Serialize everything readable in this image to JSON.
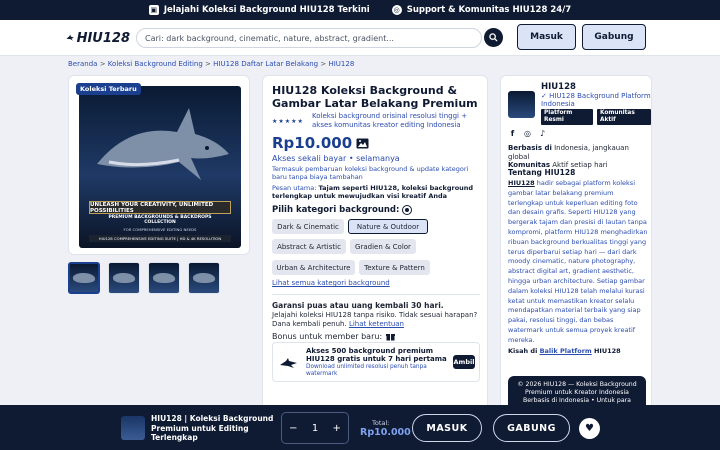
{
  "topbar": {
    "item1": "Jelajahi Koleksi Background HIU128 Terkini",
    "item2": "Support & Komunitas HIU128 24/7"
  },
  "header": {
    "brand": "HIU128",
    "search_placeholder": "Cari: dark background, cinematic, nature, abstract, gradient...",
    "masuk": "Masuk",
    "gabung": "Gabung"
  },
  "breadcrumb": [
    "Beranda",
    "Koleksi Background Editing",
    "HIU128 Daftar Latar Belakang",
    "HIU128"
  ],
  "gallery": {
    "badge": "Koleksi Terbaru",
    "hero_banner": "UNLEASH YOUR CREATIVITY, UNLIMITED POSSIBILITIES",
    "hero_sub1": "PREMIUM BACKGROUNDS & BACKDROPS COLLECTION",
    "hero_sub2": "FOR COMPREHENSIVE EDITING NEEDS",
    "hero_sub3": "HIU128 COMPREHENSIVE EDITING SUITE | HD & 4K RESOLUTION"
  },
  "product": {
    "title": "HIU128 Koleksi Background & Gambar Latar Belakang Premium",
    "stars": "★★★★★",
    "tagline": "Koleksi background orisinal resolusi tinggi + akses komunitas kreator editing Indonesia",
    "price": "Rp10.000",
    "access": "Akses sekali bayar • selamanya",
    "note": "Termasuk pembaruan koleksi background & update kategori baru tanpa biaya tambahan",
    "msg_label": "Pesan utama:",
    "msg_text": "Tajam seperti HIU128, koleksi background terlengkap untuk mewujudkan visi kreatif Anda",
    "pick_label": "Pilih kategori background:",
    "categories": [
      "Dark & Cinematic",
      "Nature & Outdoor",
      "Abstract & Artistic",
      "Gradien & Color",
      "Urban & Architecture",
      "Texture & Pattern"
    ],
    "selected_category": "Nature & Outdoor",
    "link": "Lihat semua kategori background",
    "guarantee_title": "Garansi puas atau uang kembali 30 hari.",
    "guarantee_text": "Jelajahi koleksi HIU128 tanpa risiko. Tidak sesuai harapan? Dana kembali penuh.",
    "guarantee_link": "Lihat ketentuan",
    "bonus_label": "Bonus untuk member baru:",
    "bonus_title": "Akses 500 background premium HIU128 gratis untuk 7 hari pertama",
    "bonus_sub": "Download unlimited resolusi penuh tanpa watermark",
    "bonus_btn": "Ambil"
  },
  "sidebar": {
    "name": "HIU128",
    "subtitle": "✓ HIU128 Background Platform Indonesia",
    "badges": [
      "Platform Resmi",
      "Komunitas Aktif"
    ],
    "based_label": "Berbasis di",
    "based_value": "Indonesia, jangkauan global",
    "community_label": "Komunitas",
    "community_value": "Aktif setiap hari",
    "about_title": "Tentang HIU128",
    "about_brand": "HIU128",
    "about_text": "hadir sebagai platform koleksi gambar latar belakang premium terlengkap untuk keperluan editing foto dan desain grafis. Seperti HIU128 yang bergerak tajam dan presisi di lautan tanpa kompromi, platform HIU128 menghadirkan ribuan background berkualitas tinggi yang terus diperbarui setiap hari — dari dark moody cinematic, nature photography, abstract digital art, gradient aesthetic, hingga urban architecture. Setiap gambar dalam koleksi HIU128 telah melalui kurasi ketat untuk memastikan kreator selalu mendapatkan material terbaik yang siap pakai, resolusi tinggi, dan bebas watermark untuk semua proyek kreatif mereka.",
    "story_prefix": "Kisah di",
    "story_link": "Balik Platform",
    "story_suffix": "HIU128"
  },
  "footer_note": {
    "line1": "© 2026 HIU128 — Koleksi Background Premium untuk Kreator Indonesia",
    "line2": "Berbasis di Indonesia • Untuk para"
  },
  "bottom_bar": {
    "title": "HIU128 | Koleksi Background Premium untuk Editing Terlengkap",
    "qty_minus": "−",
    "qty_value": "1",
    "qty_plus": "+",
    "total_label": "Total:",
    "total_value": "Rp10.000",
    "masuk": "MASUK",
    "gabung": "GABUNG"
  },
  "colors": {
    "navy": "#0f1a33",
    "accent": "#1b3f8f",
    "link": "#2b4db0",
    "light_accent": "#dbe4f7"
  }
}
